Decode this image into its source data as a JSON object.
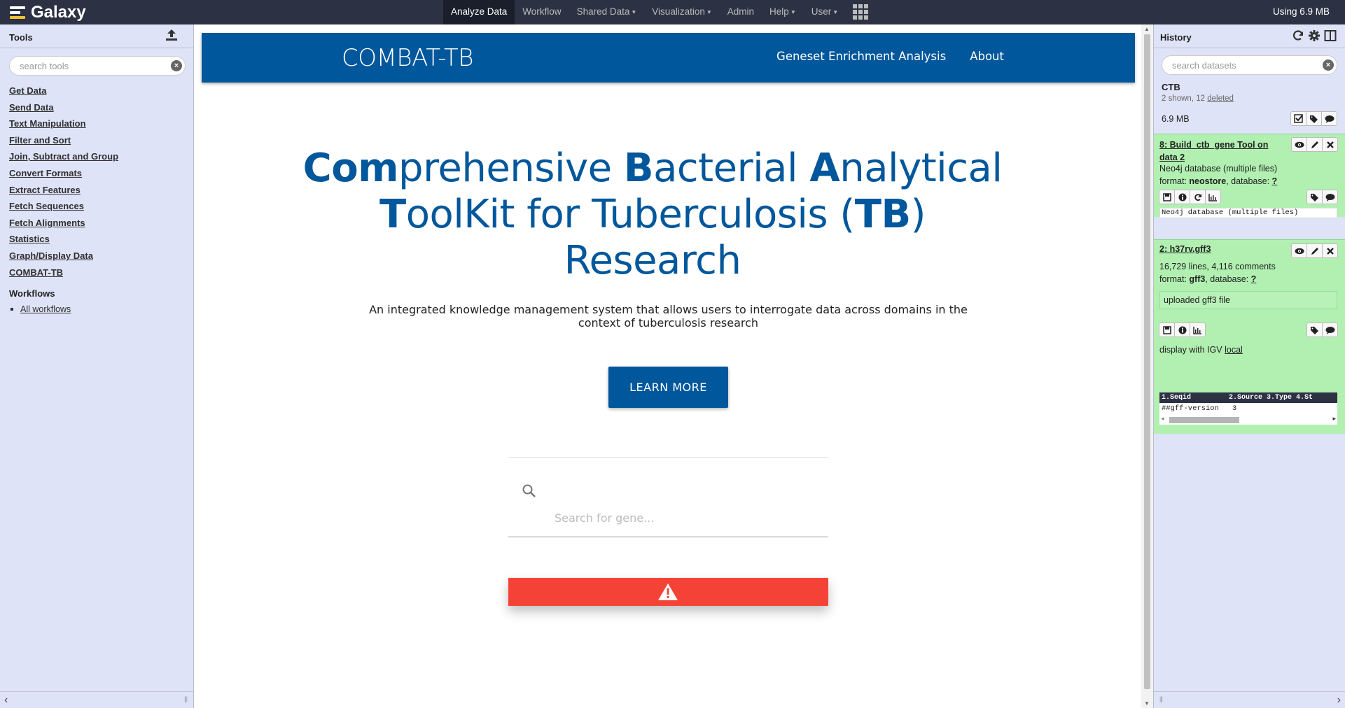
{
  "masthead": {
    "brand": "Galaxy",
    "nav": [
      {
        "label": "Analyze Data",
        "active": true,
        "dropdown": false
      },
      {
        "label": "Workflow",
        "active": false,
        "dropdown": false
      },
      {
        "label": "Shared Data",
        "active": false,
        "dropdown": true
      },
      {
        "label": "Visualization",
        "active": false,
        "dropdown": true
      },
      {
        "label": "Admin",
        "active": false,
        "dropdown": false
      },
      {
        "label": "Help",
        "active": false,
        "dropdown": true
      },
      {
        "label": "User",
        "active": false,
        "dropdown": true
      }
    ],
    "quota": "Using 6.9 MB"
  },
  "tools": {
    "title": "Tools",
    "search_placeholder": "search tools",
    "items": [
      "Get Data",
      "Send Data",
      "Text Manipulation",
      "Filter and Sort",
      "Join, Subtract and Group",
      "Convert Formats",
      "Extract Features",
      "Fetch Sequences",
      "Fetch Alignments",
      "Statistics",
      "Graph/Display Data",
      "COMBAT-TB"
    ],
    "workflows_title": "Workflows",
    "workflows_link": "All workflows"
  },
  "center": {
    "app_title": "COMBAT-TB",
    "app_nav": [
      "Geneset Enrichment Analysis",
      "About"
    ],
    "hero": {
      "w1_bold": "Com",
      "w1_rest": "prehensive ",
      "w2_bold": "B",
      "w2_rest": "acterial ",
      "w3_bold": "A",
      "w3_rest": "nalytical",
      "w4_bold": "T",
      "w4_rest": "oolKit for Tuberculosis (",
      "w5_bold": "TB",
      "w5_rest": ")",
      "w6": "Research"
    },
    "subtitle": "An integrated knowledge management system that allows users to interrogate data across domains in the context of tuberculosis research",
    "learn_more": "LEARN MORE",
    "gene_search_placeholder": "Search for gene...",
    "alert_color": "#f44336",
    "brand_color": "#01579b"
  },
  "history": {
    "title": "History",
    "search_placeholder": "search datasets",
    "name": "CTB",
    "counts_prefix": "2 shown, 12 ",
    "counts_link": "deleted",
    "size": "6.9 MB",
    "datasets": [
      {
        "title": "8: Build_ctb_gene Tool on data 2",
        "summary": "Neo4j database (multiple files)",
        "format_label": "format:",
        "format": "neostore",
        "database_label": ", database:",
        "database": "?",
        "peek": "Neo4j database (multiple files)"
      },
      {
        "title": "2: h37rv.gff3",
        "summary": "16,729 lines, 4,116 comments",
        "format_label": "format:",
        "format": "gff3",
        "database_label": ", database:",
        "database": "?",
        "info": "uploaded gff3 file",
        "display_prefix": "display with IGV ",
        "display_link": "local",
        "table_header": "1.Seqid         2.Source 3.Type 4.St",
        "table_row": "##gff-version   3"
      }
    ]
  }
}
